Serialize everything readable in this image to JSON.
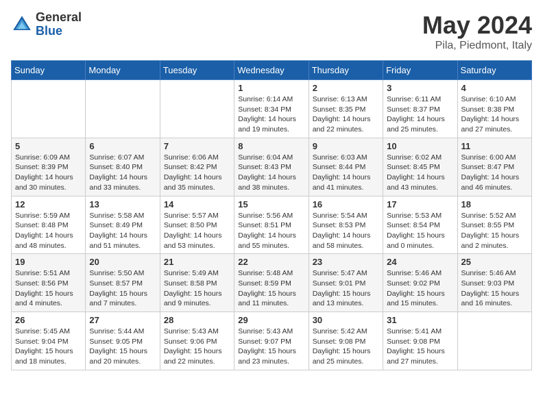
{
  "header": {
    "logo_general": "General",
    "logo_blue": "Blue",
    "title": "May 2024",
    "subtitle": "Pila, Piedmont, Italy"
  },
  "days_of_week": [
    "Sunday",
    "Monday",
    "Tuesday",
    "Wednesday",
    "Thursday",
    "Friday",
    "Saturday"
  ],
  "weeks": [
    [
      {
        "day": "",
        "info": ""
      },
      {
        "day": "",
        "info": ""
      },
      {
        "day": "",
        "info": ""
      },
      {
        "day": "1",
        "info": "Sunrise: 6:14 AM\nSunset: 8:34 PM\nDaylight: 14 hours\nand 19 minutes."
      },
      {
        "day": "2",
        "info": "Sunrise: 6:13 AM\nSunset: 8:35 PM\nDaylight: 14 hours\nand 22 minutes."
      },
      {
        "day": "3",
        "info": "Sunrise: 6:11 AM\nSunset: 8:37 PM\nDaylight: 14 hours\nand 25 minutes."
      },
      {
        "day": "4",
        "info": "Sunrise: 6:10 AM\nSunset: 8:38 PM\nDaylight: 14 hours\nand 27 minutes."
      }
    ],
    [
      {
        "day": "5",
        "info": "Sunrise: 6:09 AM\nSunset: 8:39 PM\nDaylight: 14 hours\nand 30 minutes."
      },
      {
        "day": "6",
        "info": "Sunrise: 6:07 AM\nSunset: 8:40 PM\nDaylight: 14 hours\nand 33 minutes."
      },
      {
        "day": "7",
        "info": "Sunrise: 6:06 AM\nSunset: 8:42 PM\nDaylight: 14 hours\nand 35 minutes."
      },
      {
        "day": "8",
        "info": "Sunrise: 6:04 AM\nSunset: 8:43 PM\nDaylight: 14 hours\nand 38 minutes."
      },
      {
        "day": "9",
        "info": "Sunrise: 6:03 AM\nSunset: 8:44 PM\nDaylight: 14 hours\nand 41 minutes."
      },
      {
        "day": "10",
        "info": "Sunrise: 6:02 AM\nSunset: 8:45 PM\nDaylight: 14 hours\nand 43 minutes."
      },
      {
        "day": "11",
        "info": "Sunrise: 6:00 AM\nSunset: 8:47 PM\nDaylight: 14 hours\nand 46 minutes."
      }
    ],
    [
      {
        "day": "12",
        "info": "Sunrise: 5:59 AM\nSunset: 8:48 PM\nDaylight: 14 hours\nand 48 minutes."
      },
      {
        "day": "13",
        "info": "Sunrise: 5:58 AM\nSunset: 8:49 PM\nDaylight: 14 hours\nand 51 minutes."
      },
      {
        "day": "14",
        "info": "Sunrise: 5:57 AM\nSunset: 8:50 PM\nDaylight: 14 hours\nand 53 minutes."
      },
      {
        "day": "15",
        "info": "Sunrise: 5:56 AM\nSunset: 8:51 PM\nDaylight: 14 hours\nand 55 minutes."
      },
      {
        "day": "16",
        "info": "Sunrise: 5:54 AM\nSunset: 8:53 PM\nDaylight: 14 hours\nand 58 minutes."
      },
      {
        "day": "17",
        "info": "Sunrise: 5:53 AM\nSunset: 8:54 PM\nDaylight: 15 hours\nand 0 minutes."
      },
      {
        "day": "18",
        "info": "Sunrise: 5:52 AM\nSunset: 8:55 PM\nDaylight: 15 hours\nand 2 minutes."
      }
    ],
    [
      {
        "day": "19",
        "info": "Sunrise: 5:51 AM\nSunset: 8:56 PM\nDaylight: 15 hours\nand 4 minutes."
      },
      {
        "day": "20",
        "info": "Sunrise: 5:50 AM\nSunset: 8:57 PM\nDaylight: 15 hours\nand 7 minutes."
      },
      {
        "day": "21",
        "info": "Sunrise: 5:49 AM\nSunset: 8:58 PM\nDaylight: 15 hours\nand 9 minutes."
      },
      {
        "day": "22",
        "info": "Sunrise: 5:48 AM\nSunset: 8:59 PM\nDaylight: 15 hours\nand 11 minutes."
      },
      {
        "day": "23",
        "info": "Sunrise: 5:47 AM\nSunset: 9:01 PM\nDaylight: 15 hours\nand 13 minutes."
      },
      {
        "day": "24",
        "info": "Sunrise: 5:46 AM\nSunset: 9:02 PM\nDaylight: 15 hours\nand 15 minutes."
      },
      {
        "day": "25",
        "info": "Sunrise: 5:46 AM\nSunset: 9:03 PM\nDaylight: 15 hours\nand 16 minutes."
      }
    ],
    [
      {
        "day": "26",
        "info": "Sunrise: 5:45 AM\nSunset: 9:04 PM\nDaylight: 15 hours\nand 18 minutes."
      },
      {
        "day": "27",
        "info": "Sunrise: 5:44 AM\nSunset: 9:05 PM\nDaylight: 15 hours\nand 20 minutes."
      },
      {
        "day": "28",
        "info": "Sunrise: 5:43 AM\nSunset: 9:06 PM\nDaylight: 15 hours\nand 22 minutes."
      },
      {
        "day": "29",
        "info": "Sunrise: 5:43 AM\nSunset: 9:07 PM\nDaylight: 15 hours\nand 23 minutes."
      },
      {
        "day": "30",
        "info": "Sunrise: 5:42 AM\nSunset: 9:08 PM\nDaylight: 15 hours\nand 25 minutes."
      },
      {
        "day": "31",
        "info": "Sunrise: 5:41 AM\nSunset: 9:08 PM\nDaylight: 15 hours\nand 27 minutes."
      },
      {
        "day": "",
        "info": ""
      }
    ]
  ]
}
